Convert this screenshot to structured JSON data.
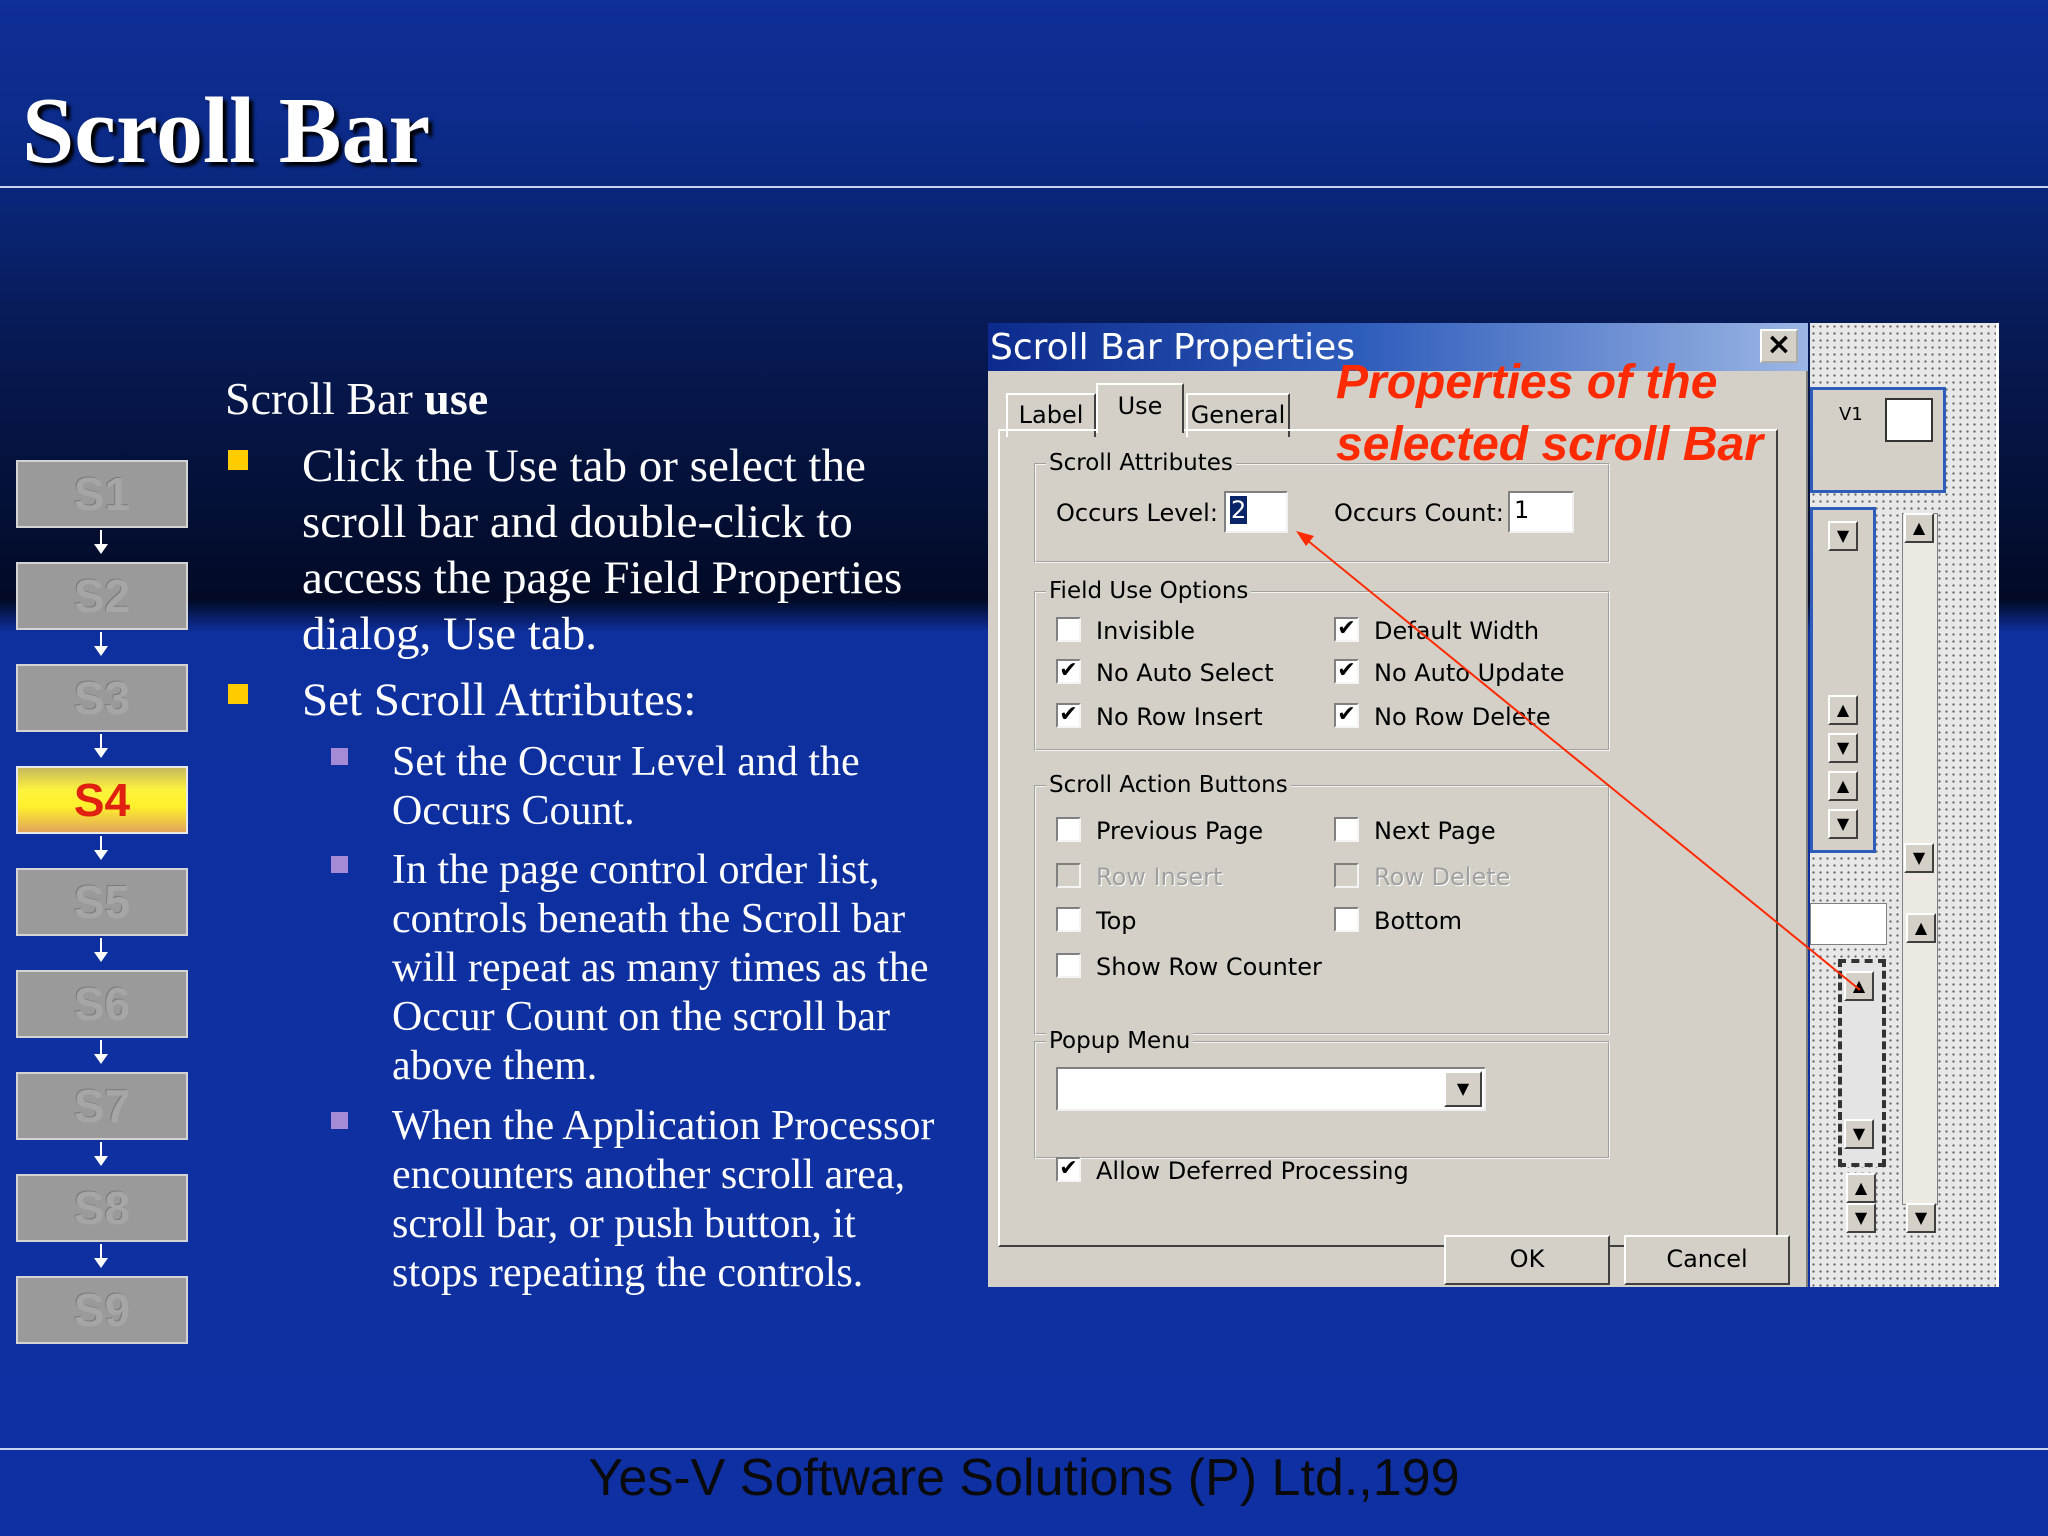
{
  "slide": {
    "title": "Scroll Bar",
    "heading_plain": "Scroll Bar ",
    "heading_bold": "use",
    "bullets": [
      {
        "lines": [
          "Click the Use tab or select the",
          "scroll bar and double-click to",
          "access the page Field Properties",
          "dialog, Use tab."
        ]
      },
      {
        "lines": [
          "Set Scroll Attributes:"
        ]
      }
    ],
    "sub_bullets": [
      {
        "lines": [
          "Set the Occur Level and the",
          "Occurs Count."
        ]
      },
      {
        "lines": [
          "In the page control order list,",
          "controls beneath the Scroll bar",
          "will repeat as many times as the",
          "Occur Count on the scroll bar",
          "above them."
        ]
      },
      {
        "lines": [
          "When the Application Processor",
          "encounters another scroll area,",
          "scroll bar, or push button, it",
          "stops repeating the controls."
        ]
      }
    ],
    "footer": "Yes-V Software Solutions (P) Ltd.,199"
  },
  "steps": [
    "S1",
    "S2",
    "S3",
    "S4",
    "S5",
    "S6",
    "S7",
    "S8",
    "S9"
  ],
  "active_step": "S4",
  "dialog": {
    "title": "Scroll Bar Properties",
    "close": "×",
    "tabs": [
      "Label",
      "Use",
      "General"
    ],
    "selected_tab": "Use",
    "scroll_attributes": {
      "label": "Scroll Attributes",
      "occurs_level_label": "Occurs Level:",
      "occurs_level_value": "2",
      "occurs_count_label": "Occurs Count:",
      "occurs_count_value": "1"
    },
    "field_use_options": {
      "label": "Field Use Options",
      "options": [
        {
          "label": "Invisible",
          "checked": false,
          "disabled": false
        },
        {
          "label": "Default Width",
          "checked": true,
          "disabled": false
        },
        {
          "label": "No Auto Select",
          "checked": true,
          "disabled": false
        },
        {
          "label": "No Auto Update",
          "checked": true,
          "disabled": false
        },
        {
          "label": "No Row Insert",
          "checked": true,
          "disabled": false
        },
        {
          "label": "No Row Delete",
          "checked": true,
          "disabled": false
        }
      ]
    },
    "scroll_action_buttons": {
      "label": "Scroll Action Buttons",
      "options": [
        {
          "label": "Previous Page",
          "checked": false,
          "disabled": false
        },
        {
          "label": "Next Page",
          "checked": false,
          "disabled": false
        },
        {
          "label": "Row Insert",
          "checked": false,
          "disabled": true
        },
        {
          "label": "Row Delete",
          "checked": false,
          "disabled": true
        },
        {
          "label": "Top",
          "checked": false,
          "disabled": false
        },
        {
          "label": "Bottom",
          "checked": false,
          "disabled": false
        },
        {
          "label": "Show Row Counter",
          "checked": false,
          "disabled": false
        }
      ]
    },
    "popup_menu": {
      "label": "Popup Menu",
      "value": ""
    },
    "allow_deferred": {
      "label": "Allow Deferred Processing",
      "checked": true
    },
    "ok": "OK",
    "cancel": "Cancel"
  },
  "annotation": [
    "Properties of the",
    "selected scroll Bar"
  ],
  "designer": {
    "label": "V1"
  },
  "colors": {
    "accent_red": "#ff2a00",
    "bullet_yellow": "#ffcc00",
    "bullet_purple": "#a58ad6",
    "titlebar_blue": "#0c2a8e"
  }
}
